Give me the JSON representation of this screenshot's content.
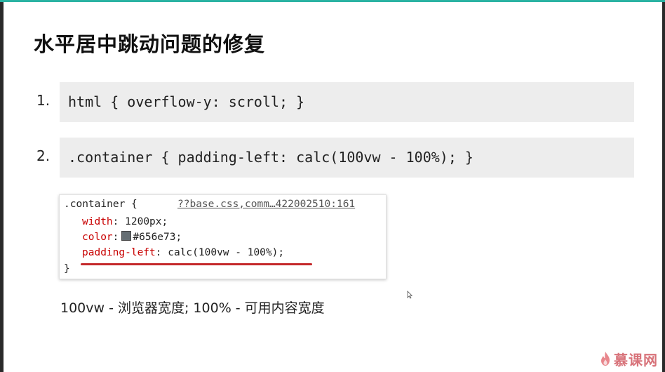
{
  "slide": {
    "title": "水平居中跳动问题的修复",
    "items": [
      {
        "number": "1.",
        "code": "html { overflow-y: scroll; }"
      },
      {
        "number": "2.",
        "code": ".container { padding-left: calc(100vw - 100%); }"
      }
    ],
    "devtools": {
      "selector_line": ".container {",
      "source": "??base.css,comm…422002510:161",
      "rules": [
        {
          "property": "width",
          "value": "1200px;"
        },
        {
          "property": "color",
          "value": "#656e73;"
        },
        {
          "property": "padding-left",
          "value": "calc(100vw - 100%);"
        }
      ],
      "close_brace": "}"
    },
    "note": "100vw - 浏览器宽度; 100% - 可用内容宽度",
    "watermark": "慕课网"
  },
  "colors": {
    "accent": "#2bb3a3",
    "css_property": "#c80000",
    "swatch": "#656e73",
    "underline": "#c4282a",
    "watermark": "#d8737a"
  }
}
